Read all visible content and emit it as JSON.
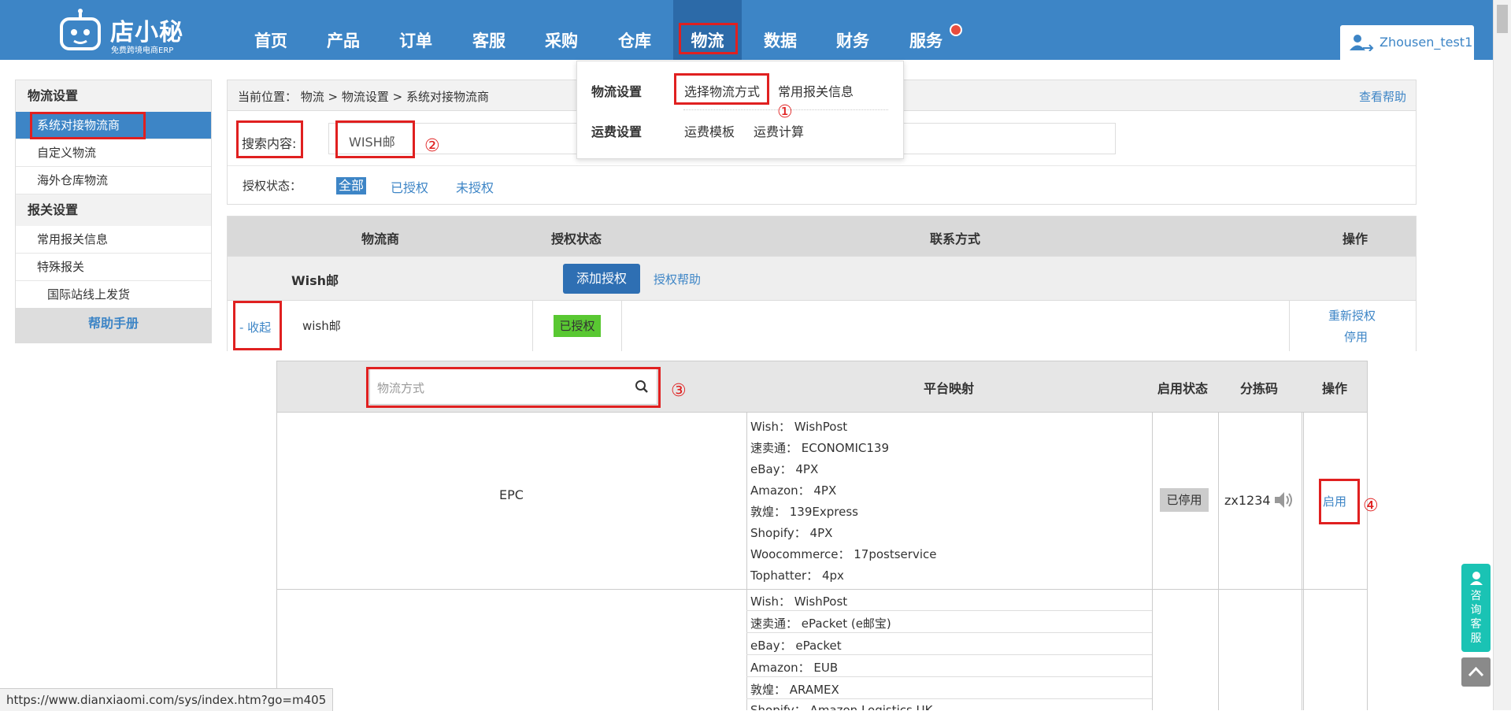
{
  "app": {
    "name": "店小秘",
    "tagline": "免费跨境电商ERP",
    "user": "Zhousen_test1"
  },
  "nav": [
    "首页",
    "产品",
    "订单",
    "客服",
    "采购",
    "仓库",
    "物流",
    "数据",
    "财务",
    "服务"
  ],
  "dropdown": {
    "row1_title": "物流设置",
    "row1_links": [
      "选择物流方式",
      "常用报关信息"
    ],
    "row2_title": "运费设置",
    "row2_links": [
      "运费模板",
      "运费计算"
    ]
  },
  "sidebar": {
    "group1": "物流设置",
    "items1": [
      "系统对接物流商",
      "自定义物流",
      "海外仓库物流"
    ],
    "group2": "报关设置",
    "items2": [
      "常用报关信息",
      "特殊报关",
      "国际站线上发货"
    ],
    "help": "帮助手册"
  },
  "breadcrumb": "当前位置：  物流 >  物流设置 > 系统对接物流商",
  "help_link": "查看帮助",
  "search": {
    "label": "搜索内容:",
    "value": "WISH邮",
    "auth_label": "授权状态：",
    "auth_options": [
      "全部",
      "已授权",
      "未授权"
    ]
  },
  "provider_table": {
    "headers": [
      "物流商",
      "授权状态",
      "联系方式",
      "操作"
    ],
    "group_name": "Wish邮",
    "add_auth": "添加授权",
    "auth_help": "授权帮助",
    "row": {
      "toggle": "- 收起",
      "name": "wish邮",
      "status": "已授权",
      "action1": "重新授权",
      "action2": "停用"
    }
  },
  "method_table": {
    "search_placeholder": "物流方式",
    "headers": [
      "平台映射",
      "启用状态",
      "分拣码",
      "操作"
    ],
    "row1": {
      "name": "EPC",
      "mappings": [
        "Wish：  WishPost",
        "速卖通：  ECONOMIC139",
        "eBay：  4PX",
        "Amazon：  4PX",
        "敦煌：  139Express",
        "Shopify：  4PX",
        "Woocommerce：  17postservice",
        "Tophatter：  4px"
      ],
      "status": "已停用",
      "code": "zx1234",
      "action": "启用"
    },
    "row2": {
      "mappings": [
        "Wish：  WishPost",
        "速卖通：  ePacket (e邮宝)",
        "eBay：  ePacket",
        "Amazon：  EUB",
        "敦煌：  ARAMEX",
        "Shopify：  Amazon Logistics UK"
      ]
    }
  },
  "annotations": [
    "①",
    "②",
    "③",
    "④"
  ],
  "widgets": {
    "consult": "咨询客服"
  },
  "status_url": "https://www.dianxiaomi.com/sys/index.htm?go=m405",
  "colors": {
    "brand_blue": "#3d85c6",
    "active_green": "#59c832",
    "annotation_red": "#e02020",
    "consult_teal": "#1ac3b4"
  }
}
